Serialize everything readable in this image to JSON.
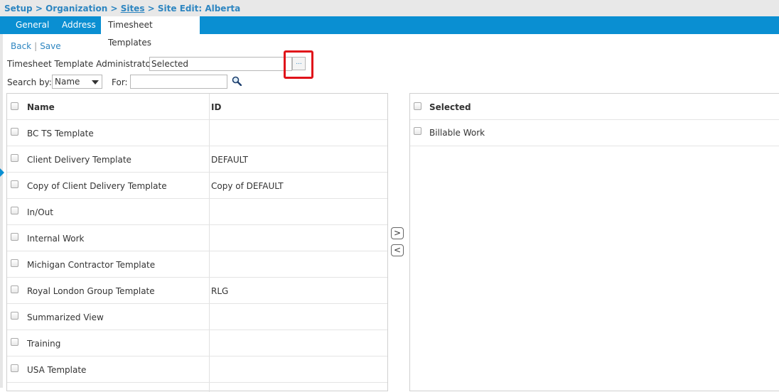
{
  "breadcrumb": {
    "setup": "Setup",
    "sep1": " > ",
    "organization": "Organization",
    "sep2": " > ",
    "sites": "Sites",
    "sep3": " > ",
    "current": "Site Edit: Alberta"
  },
  "tabs": [
    {
      "label": "General"
    },
    {
      "label": "Address"
    },
    {
      "label": "Timesheet Templates"
    }
  ],
  "actions": {
    "back": "Back",
    "sep": "|",
    "save": "Save"
  },
  "administrator": {
    "label": "Timesheet Template Administrator:",
    "value": "Selected",
    "ellipsis": "..."
  },
  "search": {
    "by_label": "Search by:",
    "by_value": "Name",
    "for_label": "For:",
    "for_value": ""
  },
  "left_table": {
    "headers": {
      "name": "Name",
      "id": "ID"
    },
    "rows": [
      {
        "name": "BC TS Template",
        "id": ""
      },
      {
        "name": "Client Delivery Template",
        "id": "DEFAULT"
      },
      {
        "name": "Copy of Client Delivery Template",
        "id": "Copy of DEFAULT"
      },
      {
        "name": "In/Out",
        "id": ""
      },
      {
        "name": "Internal Work",
        "id": ""
      },
      {
        "name": "Michigan Contractor Template",
        "id": ""
      },
      {
        "name": "Royal London Group Template",
        "id": "RLG"
      },
      {
        "name": "Summarized View",
        "id": ""
      },
      {
        "name": "Training",
        "id": ""
      },
      {
        "name": "USA Template",
        "id": ""
      }
    ]
  },
  "move": {
    "right": ">",
    "left": "<"
  },
  "right_table": {
    "header": "Selected",
    "rows": [
      {
        "name": "Billable Work"
      }
    ]
  },
  "colors": {
    "accent": "#0a8fd2",
    "link": "#2e86c1",
    "highlight": "#e0131a"
  }
}
